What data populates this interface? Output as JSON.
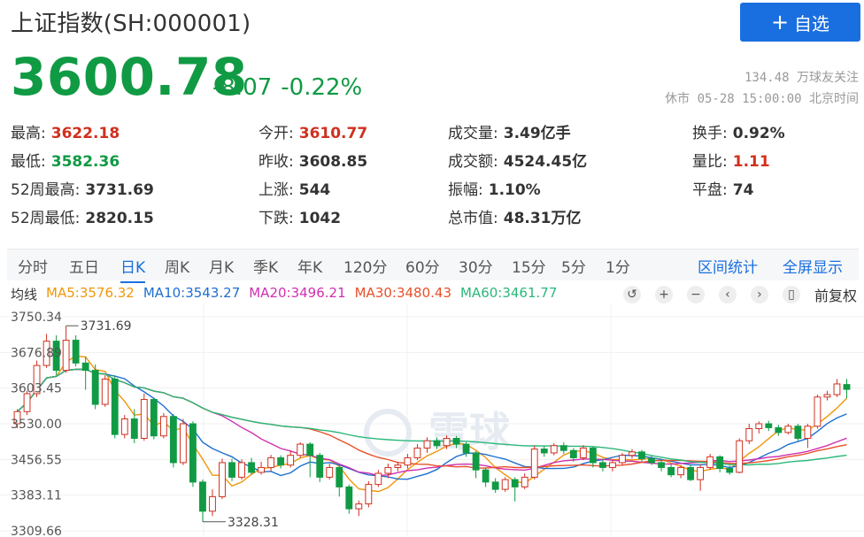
{
  "header": {
    "title": "上证指数(SH:000001)",
    "add_button": {
      "icon": "plus-icon",
      "label": "自选",
      "color": "#1a6fe0"
    },
    "price": "3600.78",
    "change": "-8.07",
    "change_pct": "-0.22%",
    "followers": "134.48 万球友关注",
    "status": "休市 05-28 15:00:00 北京时间"
  },
  "stats": [
    {
      "label": "最高:",
      "value": "3622.18",
      "tone": "red"
    },
    {
      "label": "今开:",
      "value": "3610.77",
      "tone": "red"
    },
    {
      "label": "成交量:",
      "value": "3.49亿手",
      "tone": "normal"
    },
    {
      "label": "换手:",
      "value": "0.92%",
      "tone": "normal"
    },
    {
      "label": "最低:",
      "value": "3582.36",
      "tone": "green"
    },
    {
      "label": "昨收:",
      "value": "3608.85",
      "tone": "normal"
    },
    {
      "label": "成交额:",
      "value": "4524.45亿",
      "tone": "normal"
    },
    {
      "label": "量比:",
      "value": "1.11",
      "tone": "red"
    },
    {
      "label": "52周最高:",
      "value": "3731.69",
      "tone": "normal"
    },
    {
      "label": "上涨:",
      "value": "544",
      "tone": "normal"
    },
    {
      "label": "振幅:",
      "value": "1.10%",
      "tone": "normal"
    },
    {
      "label": "平盘:",
      "value": "74",
      "tone": "normal"
    },
    {
      "label": "52周最低:",
      "value": "2820.15",
      "tone": "normal"
    },
    {
      "label": "下跌:",
      "value": "1042",
      "tone": "normal"
    },
    {
      "label": "总市值:",
      "value": "48.31万亿",
      "tone": "normal"
    }
  ],
  "tabs": {
    "items": [
      "分时",
      "五日",
      "日K",
      "周K",
      "月K",
      "季K",
      "年K",
      "120分",
      "60分",
      "30分",
      "15分",
      "5分",
      "1分"
    ],
    "active": "日K",
    "links": [
      "区间统计",
      "全屏显示"
    ]
  },
  "ma_legend": {
    "label": "均线",
    "items": [
      {
        "text": "MA5:3576.32",
        "color": "#f0960a"
      },
      {
        "text": "MA10:3543.27",
        "color": "#1e6fd0"
      },
      {
        "text": "MA20:3496.21",
        "color": "#d030b0"
      },
      {
        "text": "MA30:3480.43",
        "color": "#e8502a"
      },
      {
        "text": "MA60:3461.77",
        "color": "#2ab87a"
      }
    ]
  },
  "toolbar": {
    "icons": [
      "undo-icon",
      "zoom-in-icon",
      "zoom-out-icon",
      "scroll-left-icon",
      "scroll-right-icon",
      "candle-style-icon"
    ],
    "adjust_label": "前复权"
  },
  "chart_data": {
    "type": "candlestick",
    "y_ticks": [
      "3750.34",
      "3676.89",
      "3603.45",
      "3530.00",
      "3456.55",
      "3383.11",
      "3309.66"
    ],
    "ylim": [
      3309.66,
      3750.34
    ],
    "annotations": {
      "high": "3731.69",
      "low": "3328.31"
    },
    "up_color": "#d0301f",
    "down_color": "#109a44",
    "watermark": "雪球",
    "candles": [
      [
        3530,
        3555,
        3521,
        3560
      ],
      [
        3555,
        3592,
        3548,
        3598
      ],
      [
        3592,
        3650,
        3585,
        3660
      ],
      [
        3650,
        3700,
        3645,
        3715
      ],
      [
        3700,
        3640,
        3630,
        3712
      ],
      [
        3640,
        3702,
        3635,
        3731.69
      ],
      [
        3702,
        3655,
        3648,
        3712
      ],
      [
        3655,
        3640,
        3600,
        3668
      ],
      [
        3640,
        3570,
        3560,
        3652
      ],
      [
        3570,
        3622,
        3565,
        3630
      ],
      [
        3622,
        3508,
        3500,
        3630
      ],
      [
        3508,
        3540,
        3500,
        3548
      ],
      [
        3540,
        3500,
        3490,
        3560
      ],
      [
        3500,
        3580,
        3495,
        3592
      ],
      [
        3580,
        3505,
        3498,
        3584
      ],
      [
        3505,
        3545,
        3500,
        3552
      ],
      [
        3545,
        3450,
        3440,
        3550
      ],
      [
        3450,
        3530,
        3445,
        3540
      ],
      [
        3530,
        3410,
        3400,
        3535
      ],
      [
        3410,
        3350,
        3328.31,
        3415
      ],
      [
        3350,
        3380,
        3340,
        3395
      ],
      [
        3380,
        3450,
        3375,
        3458
      ],
      [
        3450,
        3420,
        3412,
        3458
      ],
      [
        3420,
        3450,
        3415,
        3457
      ],
      [
        3450,
        3430,
        3425,
        3460
      ],
      [
        3430,
        3440,
        3425,
        3452
      ],
      [
        3440,
        3460,
        3432,
        3466
      ],
      [
        3460,
        3445,
        3438,
        3465
      ],
      [
        3445,
        3465,
        3440,
        3475
      ],
      [
        3465,
        3488,
        3460,
        3492
      ],
      [
        3488,
        3465,
        3420,
        3492
      ],
      [
        3465,
        3420,
        3410,
        3470
      ],
      [
        3420,
        3440,
        3415,
        3448
      ],
      [
        3440,
        3400,
        3380,
        3445
      ],
      [
        3400,
        3355,
        3345,
        3405
      ],
      [
        3355,
        3365,
        3340,
        3372
      ],
      [
        3365,
        3405,
        3358,
        3412
      ],
      [
        3405,
        3428,
        3400,
        3435
      ],
      [
        3428,
        3440,
        3418,
        3448
      ],
      [
        3440,
        3445,
        3432,
        3452
      ],
      [
        3445,
        3460,
        3438,
        3468
      ],
      [
        3460,
        3480,
        3455,
        3488
      ],
      [
        3480,
        3495,
        3470,
        3502
      ],
      [
        3495,
        3485,
        3478,
        3502
      ],
      [
        3485,
        3500,
        3478,
        3506
      ],
      [
        3500,
        3488,
        3480,
        3505
      ],
      [
        3488,
        3470,
        3462,
        3492
      ],
      [
        3470,
        3435,
        3418,
        3474
      ],
      [
        3435,
        3410,
        3400,
        3440
      ],
      [
        3410,
        3395,
        3388,
        3418
      ],
      [
        3395,
        3415,
        3390,
        3420
      ],
      [
        3415,
        3400,
        3370,
        3420
      ],
      [
        3400,
        3420,
        3395,
        3428
      ],
      [
        3420,
        3478,
        3415,
        3485
      ],
      [
        3478,
        3470,
        3462,
        3484
      ],
      [
        3470,
        3485,
        3465,
        3490
      ],
      [
        3485,
        3475,
        3468,
        3492
      ],
      [
        3475,
        3460,
        3452,
        3480
      ],
      [
        3460,
        3480,
        3455,
        3486
      ],
      [
        3480,
        3450,
        3440,
        3483
      ],
      [
        3450,
        3440,
        3432,
        3458
      ],
      [
        3440,
        3450,
        3432,
        3455
      ],
      [
        3450,
        3465,
        3445,
        3470
      ],
      [
        3465,
        3472,
        3458,
        3478
      ],
      [
        3472,
        3458,
        3452,
        3476
      ],
      [
        3458,
        3450,
        3445,
        3464
      ],
      [
        3450,
        3440,
        3432,
        3456
      ],
      [
        3440,
        3425,
        3420,
        3446
      ],
      [
        3425,
        3440,
        3418,
        3445
      ],
      [
        3440,
        3415,
        3412,
        3445
      ],
      [
        3415,
        3440,
        3392,
        3446
      ],
      [
        3440,
        3462,
        3435,
        3468
      ],
      [
        3462,
        3438,
        3430,
        3465
      ],
      [
        3438,
        3430,
        3425,
        3444
      ],
      [
        3430,
        3495,
        3428,
        3500
      ],
      [
        3495,
        3520,
        3488,
        3530
      ],
      [
        3520,
        3530,
        3510,
        3535
      ],
      [
        3530,
        3522,
        3515,
        3536
      ],
      [
        3522,
        3512,
        3505,
        3528
      ],
      [
        3512,
        3525,
        3508,
        3530
      ],
      [
        3525,
        3500,
        3495,
        3530
      ],
      [
        3500,
        3525,
        3480,
        3530
      ],
      [
        3525,
        3585,
        3520,
        3590
      ],
      [
        3585,
        3590,
        3578,
        3598
      ],
      [
        3590,
        3612,
        3585,
        3622
      ],
      [
        3610.77,
        3600.78,
        3582.36,
        3622.18
      ]
    ]
  }
}
